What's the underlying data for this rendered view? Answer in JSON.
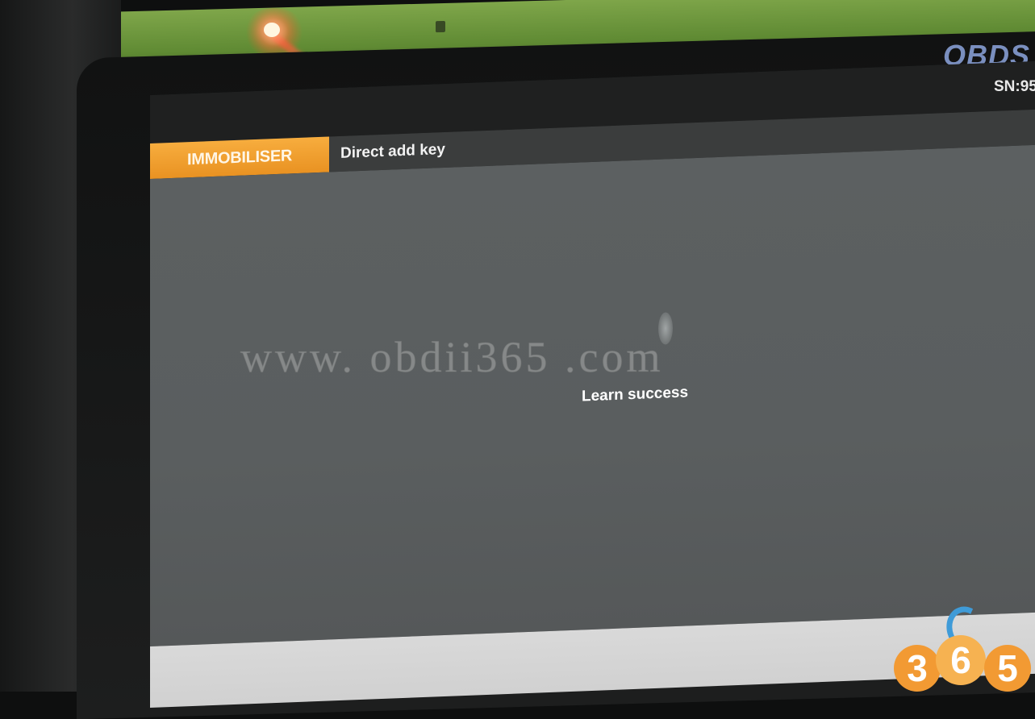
{
  "device": {
    "brand_text": "OBDS",
    "serial_label": "SN:95"
  },
  "app": {
    "module_tab": "IMMOBILISER",
    "breadcrumb": "Direct add key"
  },
  "dialog": {
    "message": "Learn success"
  },
  "overlay": {
    "watermark": "www. obdii365 .com",
    "logo_digits": [
      "3",
      "6",
      "5"
    ]
  },
  "colors": {
    "accent_orange": "#F39A2B",
    "titlebar": "#3B3D3D",
    "content_bg": "#5C6061",
    "footer_bg": "#D6D6D6"
  }
}
